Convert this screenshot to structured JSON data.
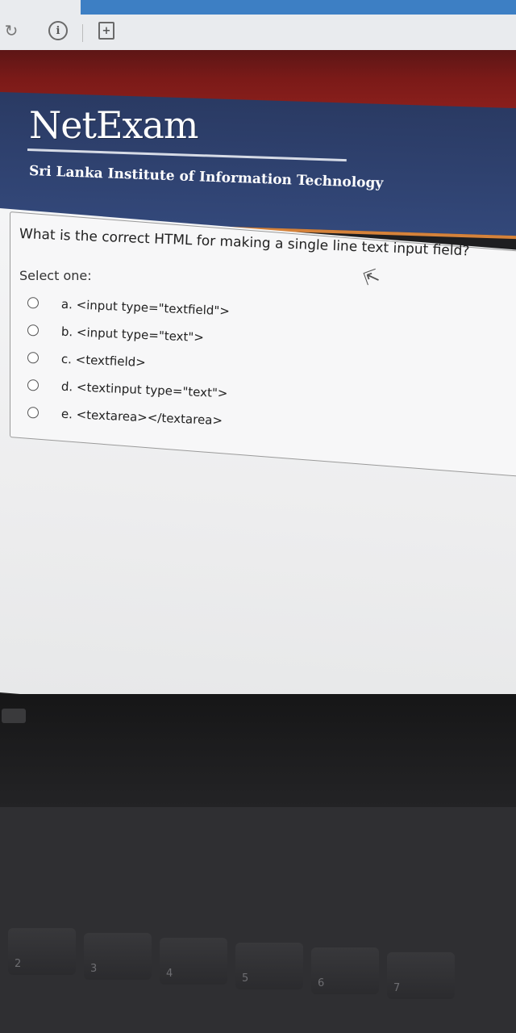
{
  "browser": {
    "reload_icon": "reload-icon",
    "info_icon": "info-icon",
    "info_glyph": "i",
    "bookmark_icon": "bookmark-add-icon",
    "bookmark_glyph": "+"
  },
  "header": {
    "logo": "NetExam",
    "subtitle": "Sri Lanka Institute of Information Technology"
  },
  "quiz": {
    "question": "What is the correct HTML for making a single line text input field?",
    "prompt": "Select one:",
    "options": [
      {
        "label": "a. <input type=\"textfield\">",
        "selected": false
      },
      {
        "label": "b. <input type=\"text\">",
        "selected": false
      },
      {
        "label": "c. <textfield>",
        "selected": false
      },
      {
        "label": "d. <textinput type=\"text\">",
        "selected": false
      },
      {
        "label": "e. <textarea></textarea>",
        "selected": false
      }
    ]
  },
  "keyboard": {
    "keys": [
      "@",
      "2",
      "#",
      "3",
      "$",
      "4",
      "%",
      "5",
      "^",
      "6",
      "&",
      "7"
    ]
  },
  "colors": {
    "header_bg": "#2a3a63",
    "accent_band": "#7b1a18",
    "header_rule": "#d5823a",
    "tab_blue": "#3d7fc4"
  }
}
